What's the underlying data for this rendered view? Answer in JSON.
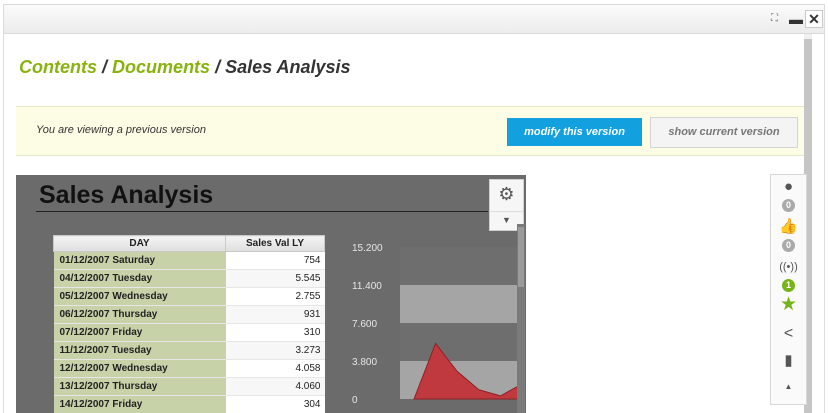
{
  "window": {
    "expand_icon": "expand-arrows-icon",
    "minimize_icon": "minimize-icon",
    "close_icon": "close-icon"
  },
  "breadcrumb": {
    "items": [
      "Contents",
      "Documents",
      "Sales Analysis"
    ],
    "separator": "/"
  },
  "version_bar": {
    "message": "You are viewing a previous version",
    "modify_label": "modify this version",
    "show_current_label": "show current version"
  },
  "report": {
    "title": "Sales Analysis",
    "gear_icon": "gear-icon",
    "dropdown_icon": "caret-down-icon",
    "table": {
      "columns": [
        "DAY",
        "Sales Val LY"
      ],
      "rows": [
        [
          "01/12/2007 Saturday",
          "754"
        ],
        [
          "04/12/2007 Tuesday",
          "5.545"
        ],
        [
          "05/12/2007 Wednesday",
          "2.755"
        ],
        [
          "06/12/2007 Thursday",
          "931"
        ],
        [
          "07/12/2007 Friday",
          "310"
        ],
        [
          "11/12/2007 Tuesday",
          "3.273"
        ],
        [
          "12/12/2007 Wednesday",
          "4.058"
        ],
        [
          "13/12/2007 Thursday",
          "4.060"
        ],
        [
          "14/12/2007 Friday",
          "304"
        ]
      ]
    },
    "chart": {
      "y_ticks": [
        "15.200",
        "11.400",
        "7.600",
        "3.800",
        "0"
      ],
      "area_color": "#c0393e",
      "points": [
        0,
        5545,
        2755,
        931,
        310,
        1500
      ]
    }
  },
  "side_toolbar": {
    "items": [
      {
        "icon": "user-icon",
        "badge": "0",
        "badge_color": "#aaaaaa"
      },
      {
        "icon": "thumbs-up-icon",
        "badge": "0",
        "badge_color": "#aaaaaa"
      },
      {
        "icon": "broadcast-icon",
        "badge": "1",
        "badge_color": "#77b41a"
      },
      {
        "icon": "star-icon",
        "color": "#77b41a"
      },
      {
        "icon": "share-icon"
      },
      {
        "icon": "bookmark-icon"
      },
      {
        "icon": "caret-up-icon"
      }
    ]
  },
  "colors": {
    "accent_green": "#8ab20e",
    "primary_button": "#12a0df",
    "notice_background": "#fdfde6"
  }
}
